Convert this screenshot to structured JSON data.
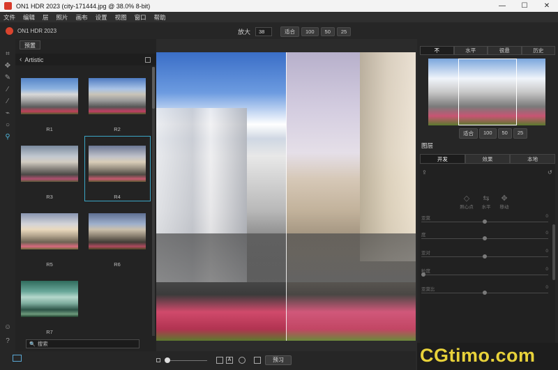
{
  "window": {
    "title": "ON1 HDR 2023 (city-171444.jpg @ 38.0% 8-bit)",
    "controls": [
      "—",
      "☐",
      "✕"
    ]
  },
  "menu": [
    "文件",
    "编辑",
    "层",
    "照片",
    "画布",
    "设置",
    "视图",
    "窗口",
    "帮助"
  ],
  "app": {
    "name": "ON1 HDR 2023"
  },
  "zoom": {
    "label": "放大",
    "value": "38",
    "buttons": [
      "适合",
      "100",
      "50",
      "25"
    ]
  },
  "presets": {
    "tab": "预置",
    "category": "Artistic",
    "items": [
      {
        "label": "R1"
      },
      {
        "label": "R2"
      },
      {
        "label": "R3"
      },
      {
        "label": "R4"
      },
      {
        "label": "R5"
      },
      {
        "label": "R6"
      },
      {
        "label": "R7"
      }
    ],
    "selected": "R4",
    "search_placeholder": "搜索"
  },
  "canvas": {
    "preview_label": "预习",
    "split": true
  },
  "navigator": {
    "tabs": [
      "不",
      "水平",
      "很悬",
      "历史"
    ],
    "zoom_buttons": [
      "适合",
      "100",
      "50",
      "25"
    ]
  },
  "layers": {
    "header": "图层",
    "tabs": [
      "开发",
      "效果",
      "本地"
    ],
    "modes": [
      {
        "label": "照心点",
        "icon": "mask-icon"
      },
      {
        "label": "水平",
        "icon": "horizontal-icon"
      },
      {
        "label": "移动",
        "icon": "move-icon"
      }
    ],
    "sliders": [
      {
        "name": "亚莫",
        "value": "0",
        "pos": 0.5
      },
      {
        "name": "度",
        "value": "0",
        "pos": 0.5
      },
      {
        "name": "亚对",
        "value": "0",
        "pos": 0.5
      },
      {
        "name": "粒度",
        "value": "0",
        "pos": 0.0
      },
      {
        "name": "亚莫比",
        "value": "0",
        "pos": 0.5
      }
    ]
  },
  "watermark": "CGtimo.com",
  "colors": {
    "accent": "#3ba6c6",
    "watermark": "#e8d23a"
  }
}
